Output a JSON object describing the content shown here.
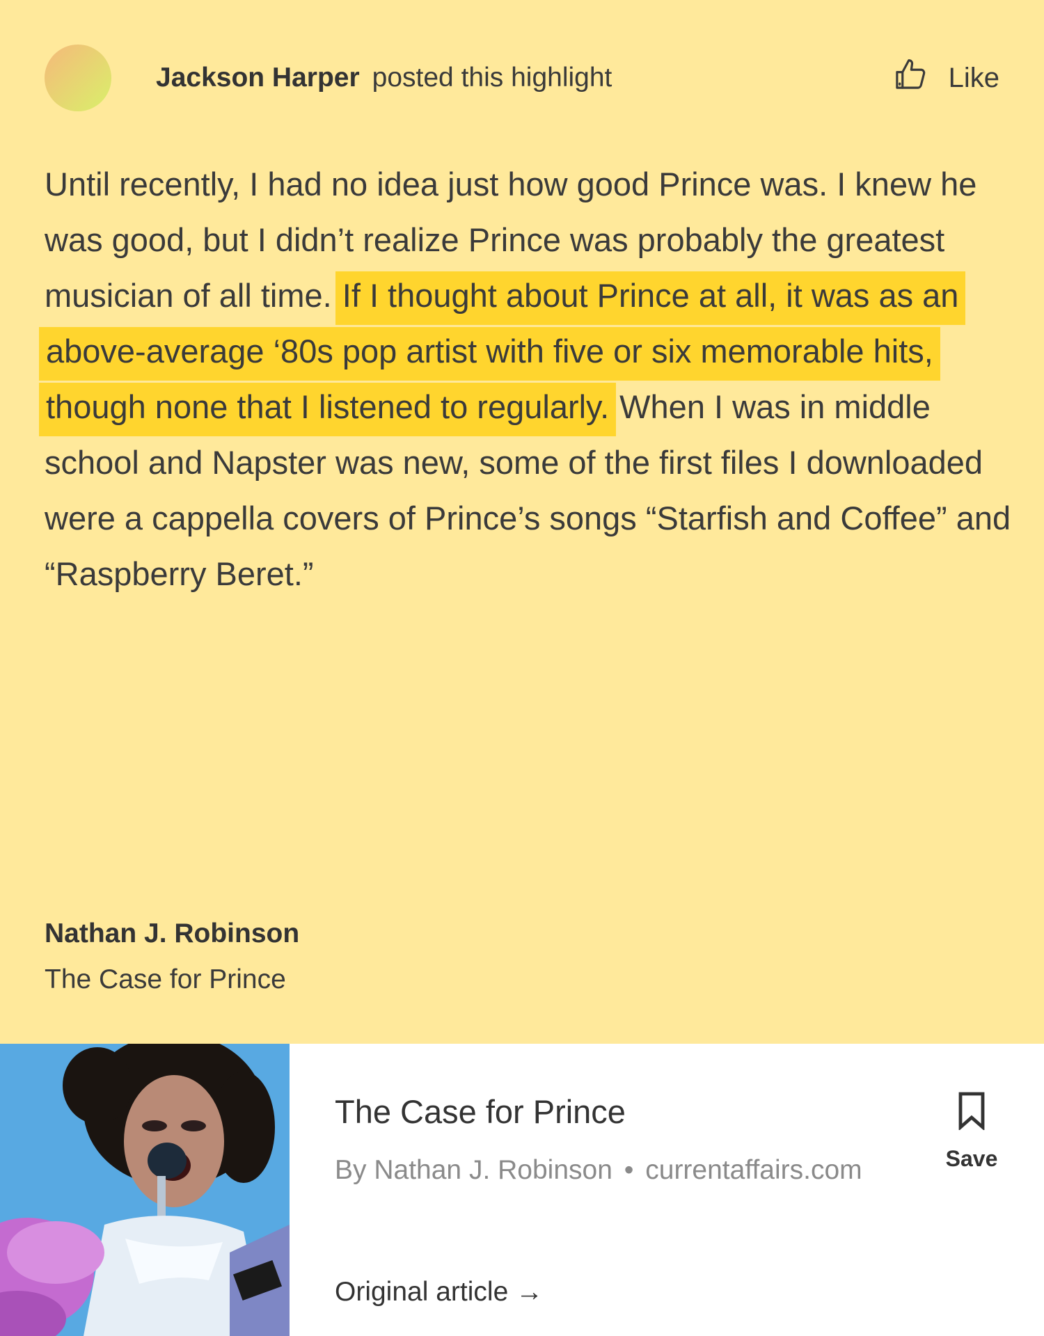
{
  "header": {
    "poster_name": "Jackson Harper",
    "poster_action": "posted this highlight",
    "like_label": "Like"
  },
  "quote": {
    "before": "Until recently, I had no idea just how good Prince was. I knew he was good, but I didn’t realize Prince was probably the greatest musician of all time. ",
    "highlight": "If I thought about Prince at all, it was as an above-average ‘80s pop artist with five or six memorable hits, though none that I listened to regularly.",
    "after": " When I was in middle school and Napster was new, some of the first files I downloaded were a cappella covers of Prince’s songs “Starfish and Coffee” and “Raspberry Beret.”"
  },
  "source": {
    "author": "Nathan J. Robinson",
    "title": "The Case for Prince"
  },
  "link_card": {
    "title": "The Case for Prince",
    "byline": "By Nathan J. Robinson",
    "separator": "•",
    "domain": "currentaffairs.com",
    "original_label": "Original article →",
    "save_label": "Save",
    "thumbnail_alt": "Prince singing into a microphone"
  },
  "colors": {
    "card_background": "#ffe99b",
    "highlight": "#ffd52e",
    "link_card_background": "#ffffff"
  },
  "icons": {
    "like": "thumbs-up-icon",
    "save": "bookmark-icon"
  }
}
